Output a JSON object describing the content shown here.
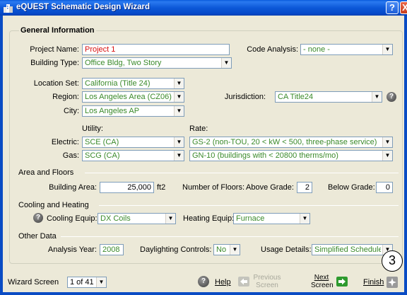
{
  "window": {
    "title": "eQUEST Schematic Design Wizard",
    "help_button": "?",
    "close_button": "X"
  },
  "general": {
    "group_title": "General Information",
    "project_name_label": "Project Name:",
    "project_name_value": "Project 1",
    "code_analysis_label": "Code Analysis:",
    "code_analysis_value": "- none -",
    "building_type_label": "Building Type:",
    "building_type_value": "Office Bldg, Two Story",
    "location_set_label": "Location Set:",
    "location_set_value": "California (Title 24)",
    "region_label": "Region:",
    "region_value": "Los Angeles Area (CZ06)",
    "jurisdiction_label": "Jurisdiction:",
    "jurisdiction_value": "CA Title24",
    "city_label": "City:",
    "city_value": "Los Angeles AP",
    "utility_header": "Utility:",
    "rate_header": "Rate:",
    "electric_label": "Electric:",
    "electric_utility": "SCE (CA)",
    "electric_rate": "GS-2 (non-TOU, 20 < kW < 500, three-phase service)",
    "gas_label": "Gas:",
    "gas_utility": "SCG (CA)",
    "gas_rate": "GN-10 (buildings with < 20800 therms/mo)"
  },
  "area": {
    "section_title": "Area and Floors",
    "building_area_label": "Building Area:",
    "building_area_value": "25,000",
    "building_area_unit": "ft2",
    "floors_label": "Number of Floors:",
    "above_grade_label": "Above Grade:",
    "above_grade_value": "2",
    "below_grade_label": "Below Grade:",
    "below_grade_value": "0"
  },
  "cooling": {
    "section_title": "Cooling and Heating",
    "cooling_equip_label": "Cooling Equip:",
    "cooling_equip_value": "DX Coils",
    "heating_equip_label": "Heating Equip:",
    "heating_equip_value": "Furnace"
  },
  "other": {
    "section_title": "Other Data",
    "analysis_year_label": "Analysis Year:",
    "analysis_year_value": "2008",
    "daylighting_label": "Daylighting Controls:",
    "daylighting_value": "No",
    "usage_details_label": "Usage Details:",
    "usage_details_value": "Simplified Schedules"
  },
  "nav": {
    "wizard_screen_label": "Wizard Screen",
    "wizard_screen_value": "1 of 41",
    "help_label": "Help",
    "previous_label_1": "Previous",
    "previous_label_2": "Screen",
    "next_label_1": "Next",
    "next_label_2": "Screen",
    "finish_label": "Finish",
    "marker_number": "3"
  },
  "colors": {
    "title_bar": "#0a5bdc",
    "field_text": "#3a8a2a",
    "project_name_text": "#d81010",
    "next_arrow": "#2e9a2e"
  }
}
